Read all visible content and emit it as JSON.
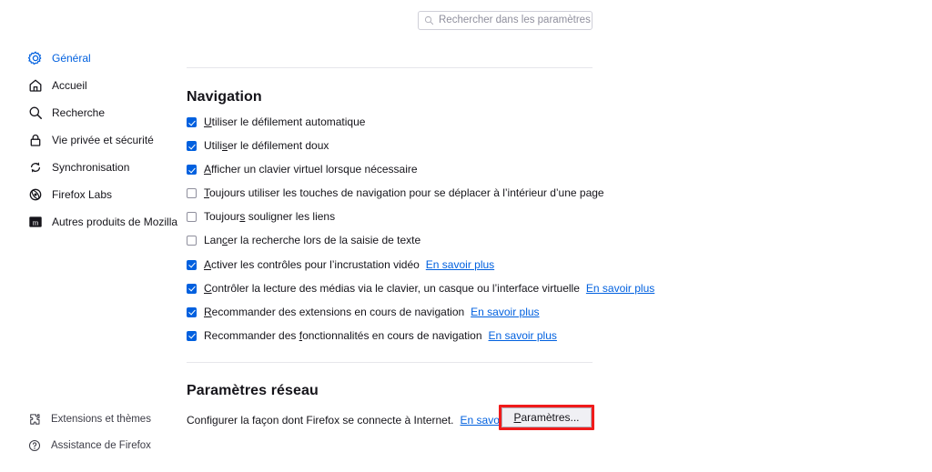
{
  "search": {
    "placeholder": "Rechercher dans les paramètres",
    "icon": "search-icon"
  },
  "sidebar": {
    "top_items": [
      {
        "label": "Général",
        "icon": "gear-icon",
        "active": true
      },
      {
        "label": "Accueil",
        "icon": "home-icon",
        "active": false
      },
      {
        "label": "Recherche",
        "icon": "search-icon",
        "active": false
      },
      {
        "label": "Vie privée et sécurité",
        "icon": "lock-icon",
        "active": false
      },
      {
        "label": "Synchronisation",
        "icon": "sync-icon",
        "active": false
      },
      {
        "label": "Firefox Labs",
        "icon": "atom-icon",
        "active": false
      },
      {
        "label": "Autres produits de Mozilla",
        "icon": "mozilla-m-icon",
        "active": false
      }
    ],
    "bottom_items": [
      {
        "label": "Extensions et thèmes",
        "icon": "puzzle-piece-icon"
      },
      {
        "label": "Assistance de Firefox",
        "icon": "question-circle-icon"
      }
    ]
  },
  "navigation_section": {
    "title": "Navigation",
    "options": [
      {
        "checked": true,
        "accesskey": "U",
        "label_before": "",
        "label_rest": "tiliser le défilement automatique",
        "link": ""
      },
      {
        "checked": true,
        "accesskey": "s",
        "label_before": "Utili",
        "label_rest": "er le défilement doux",
        "link": ""
      },
      {
        "checked": true,
        "accesskey": "A",
        "label_before": "",
        "label_rest": "fficher un clavier virtuel lorsque nécessaire",
        "link": ""
      },
      {
        "checked": false,
        "accesskey": "T",
        "label_before": "",
        "label_rest": "oujours utiliser les touches de navigation pour se déplacer à l’intérieur d’une page",
        "link": ""
      },
      {
        "checked": false,
        "accesskey": "s",
        "label_before": "Toujour",
        "label_rest": " souligner les liens",
        "link": ""
      },
      {
        "checked": false,
        "accesskey": "c",
        "label_before": "Lan",
        "label_rest": "er la recherche lors de la saisie de texte",
        "link": ""
      },
      {
        "checked": true,
        "accesskey": "A",
        "label_before": "",
        "label_rest": "ctiver les contrôles pour l’incrustation vidéo",
        "link": "En savoir plus"
      },
      {
        "checked": true,
        "accesskey": "C",
        "label_before": "",
        "label_rest": "ontrôler la lecture des médias via le clavier, un casque ou l’interface virtuelle",
        "link": "En savoir plus"
      },
      {
        "checked": true,
        "accesskey": "R",
        "label_before": "",
        "label_rest": "ecommander des extensions en cours de navigation",
        "link": "En savoir plus"
      },
      {
        "checked": true,
        "accesskey": "f",
        "label_before": "Recommander des ",
        "label_rest": "onctionnalités en cours de navigation",
        "link": "En savoir plus"
      }
    ]
  },
  "network_section": {
    "title": "Paramètres réseau",
    "description": "Configurer la façon dont Firefox se connecte à Internet.",
    "link": "En savoir plus",
    "button_accesskey": "P",
    "button_label_rest": "aramètres...",
    "highlight_color": "#f01b1b"
  },
  "colors": {
    "accent": "#0060df",
    "text": "#15141a",
    "muted": "#5b5b66",
    "divider": "#e6e6eb"
  }
}
